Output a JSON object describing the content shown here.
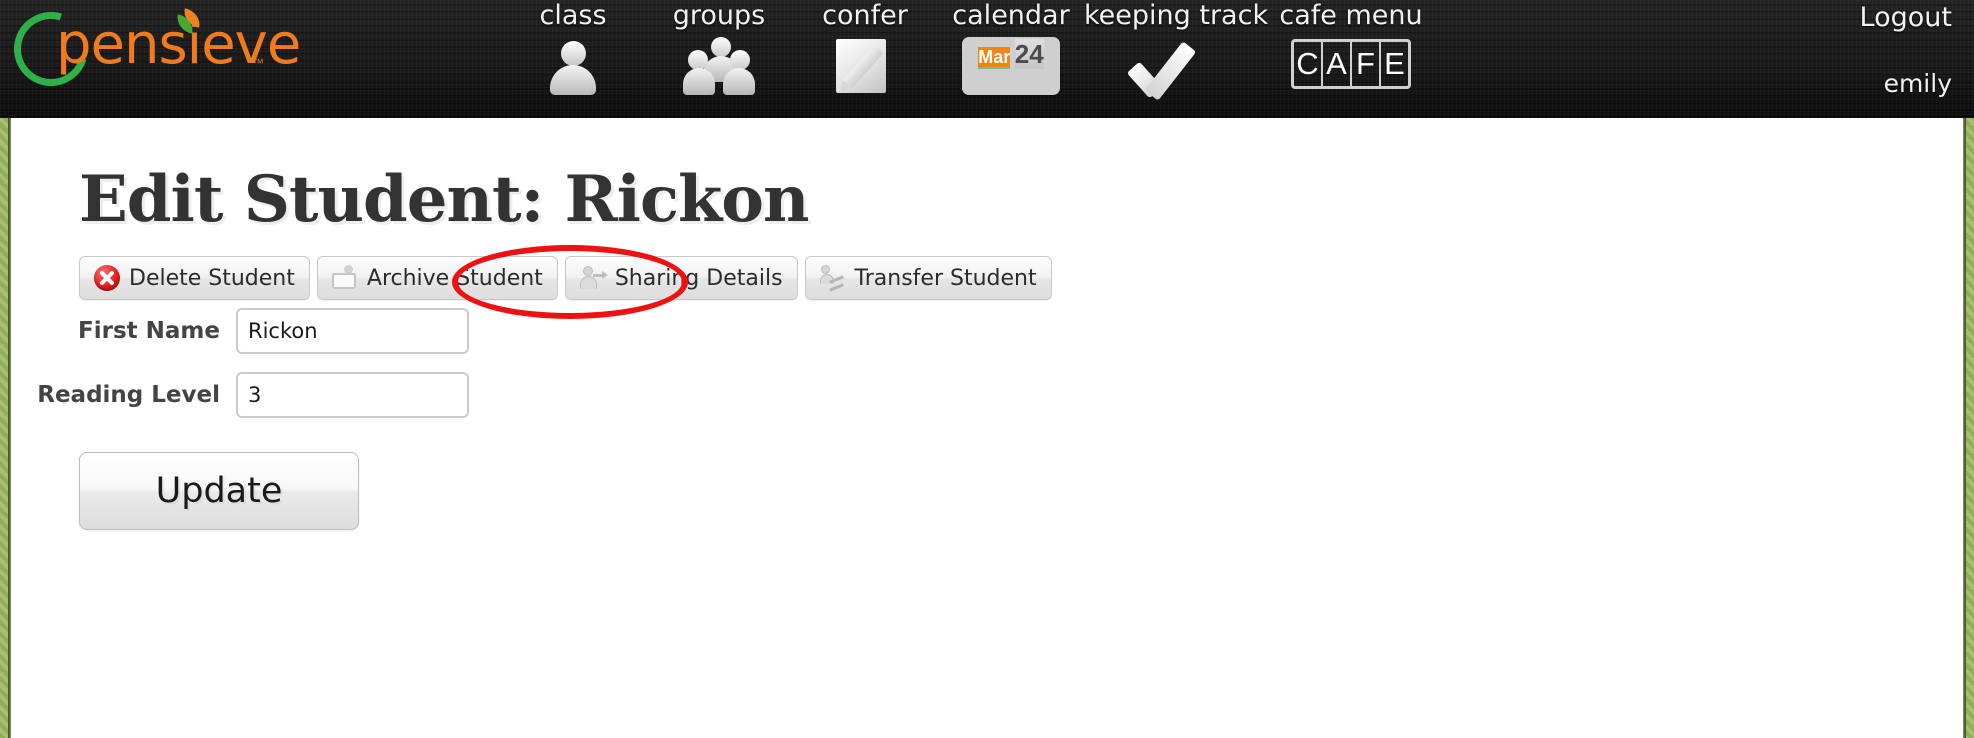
{
  "brand": {
    "name": "pensieve",
    "trademark": "™",
    "ring_color": "#2fb14a",
    "word_color": "#f07b1e"
  },
  "nav": {
    "items": [
      {
        "label": "class",
        "icon": "person-icon"
      },
      {
        "label": "groups",
        "icon": "people-group-icon"
      },
      {
        "label": "confer",
        "icon": "note-pencil-icon"
      },
      {
        "label": "calendar",
        "icon": "calendar-icon",
        "month": "Mar",
        "day": "24"
      },
      {
        "label": "keeping track",
        "icon": "checkmark-icon"
      },
      {
        "label": "cafe menu",
        "icon": "cafe-icon",
        "cells": [
          "C",
          "A",
          "F",
          "E"
        ]
      }
    ]
  },
  "account": {
    "logout_label": "Logout",
    "username": "emily"
  },
  "main": {
    "page_title": "Edit Student: Rickon",
    "actions": [
      {
        "label": "Delete Student",
        "icon": "delete-circle-icon"
      },
      {
        "label": "Archive Student",
        "icon": "archive-folder-icon"
      },
      {
        "label": "Sharing Details",
        "icon": "share-person-icon"
      },
      {
        "label": "Transfer Student",
        "icon": "transfer-person-icon"
      }
    ],
    "annotation": {
      "target": "Sharing Details",
      "shape": "ellipse",
      "color": "#ee1111"
    },
    "form": {
      "fields": [
        {
          "label": "First Name",
          "value": "Rickon",
          "placeholder": ""
        },
        {
          "label": "Reading Level",
          "value": "3",
          "placeholder": ""
        }
      ],
      "submit_label": "Update"
    }
  },
  "theme": {
    "header_bg": "#1c1c1c",
    "page_bg": "#8fae55",
    "accent_orange": "#f08515",
    "title_color": "#333333"
  }
}
